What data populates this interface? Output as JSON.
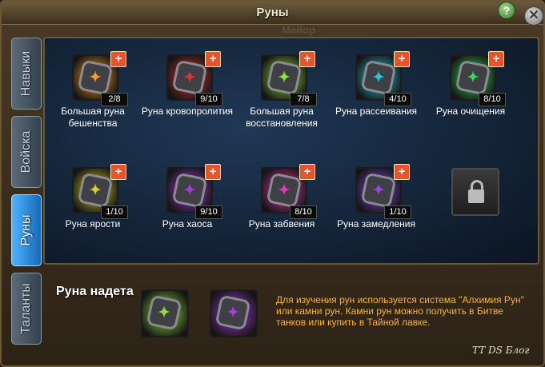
{
  "window": {
    "title": "Руны",
    "ghost_text": "Майор"
  },
  "tabs": [
    {
      "label": "Навыки",
      "active": false
    },
    {
      "label": "Войска",
      "active": false
    },
    {
      "label": "Руны",
      "active": true
    },
    {
      "label": "Таланты",
      "active": false
    }
  ],
  "runes": [
    {
      "name": "Большая руна бешенства",
      "level": "2/8",
      "color": "#ff9a1a",
      "icon": "fury-rune-icon"
    },
    {
      "name": "Руна кровопролития",
      "level": "9/10",
      "color": "#e03030",
      "icon": "bloodshed-rune-icon"
    },
    {
      "name": "Большая руна восстановления",
      "level": "7/8",
      "color": "#8fe03a",
      "icon": "restoration-rune-icon"
    },
    {
      "name": "Руна рассеивания",
      "level": "4/10",
      "color": "#27c6d8",
      "icon": "dispersion-rune-icon"
    },
    {
      "name": "Руна очищения",
      "level": "8/10",
      "color": "#2fd85a",
      "icon": "purification-rune-icon"
    },
    {
      "name": "Руна ярости",
      "level": "1/10",
      "color": "#d6d21e",
      "icon": "rage-rune-icon"
    },
    {
      "name": "Руна хаоса",
      "level": "9/10",
      "color": "#a63adf",
      "icon": "chaos-rune-icon"
    },
    {
      "name": "Руна забвения",
      "level": "8/10",
      "color": "#e03ab0",
      "icon": "oblivion-rune-icon"
    },
    {
      "name": "Руна замедления",
      "level": "1/10",
      "color": "#8a4ae0",
      "icon": "slowdown-rune-icon"
    }
  ],
  "locked_slot": {
    "icon": "padlock-icon"
  },
  "equipped": {
    "label": "Руна надета",
    "runes": [
      {
        "color": "#8fe03a",
        "icon": "restoration-rune-icon"
      },
      {
        "color": "#a63adf",
        "icon": "chaos-rune-icon"
      }
    ]
  },
  "info_text": "Для изучения рун используется система \"Алхимия Рун\" или камни рун. Камни рун можно получить в Битве танков или купить в Тайной лавке.",
  "watermark": "TT DS Блог"
}
